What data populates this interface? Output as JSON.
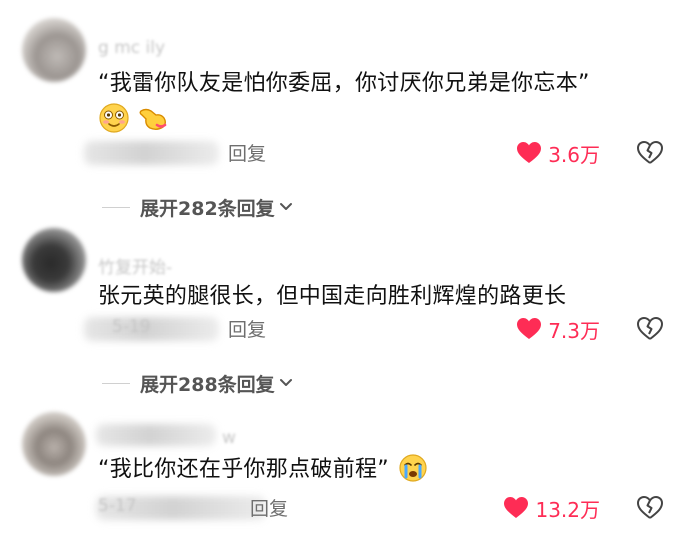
{
  "comments": [
    {
      "username": "g  mc  ily",
      "text": "“我雷你队友是怕你委屈，你讨厌你兄弟是你忘本”",
      "emojis": [
        "flushed-smile-emoji",
        "pointing-hand-emoji"
      ],
      "reply_label": "回复",
      "likes": "3.6万",
      "expand_label": "展开282条回复"
    },
    {
      "username": "竹复开始-",
      "text": "张元英的腿很长，但中国走向胜利辉煌的路更长",
      "date": "5-19",
      "reply_label": "回复",
      "likes": "7.3万",
      "expand_label": "展开288条回复"
    },
    {
      "username": "w",
      "text": "“我比你还在乎你那点破前程”",
      "emojis": [
        "crying-face-emoji"
      ],
      "date": "5-17",
      "reply_label": "回复",
      "likes": "13.2万"
    }
  ],
  "colors": {
    "like_red": "#fe2c55",
    "text": "#111111",
    "muted": "#6e6e6e"
  }
}
